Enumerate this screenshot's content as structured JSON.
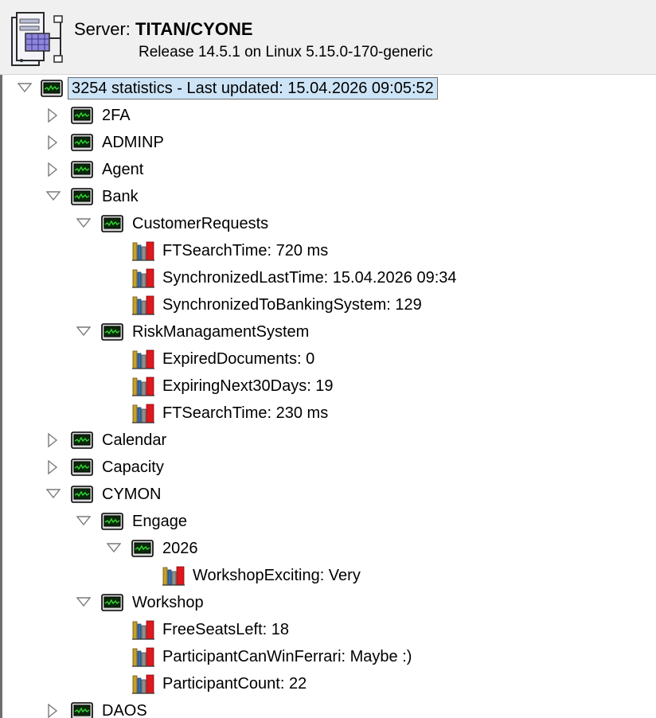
{
  "header": {
    "server_prefix": "Server:",
    "server_name": "TITAN/CYONE",
    "release": "Release 14.5.1 on Linux 5.15.0-170-generic"
  },
  "tree": {
    "root": "3254 statistics - Last updated: 15.04.2026 09:05:52",
    "n_2fa": "2FA",
    "n_adminp": "ADMINP",
    "n_agent": "Agent",
    "n_bank": "Bank",
    "n_customer_requests": "CustomerRequests",
    "s_ftsearch_720": "FTSearchTime: 720 ms",
    "s_sync_last": "SynchronizedLastTime: 15.04.2026 09:34",
    "s_sync_bank": "SynchronizedToBankingSystem: 129",
    "n_risk": "RiskManagamentSystem",
    "s_expired": "ExpiredDocuments: 0",
    "s_expiring": "ExpiringNext30Days: 19",
    "s_ftsearch_230": "FTSearchTime: 230 ms",
    "n_calendar": "Calendar",
    "n_capacity": "Capacity",
    "n_cymon": "CYMON",
    "n_engage": "Engage",
    "n_2026": "2026",
    "s_workshop_exciting": "WorkshopExciting: Very",
    "n_workshop": "Workshop",
    "s_free_seats": "FreeSeatsLeft: 18",
    "s_ferrari": "ParticipantCanWinFerrari: Maybe :)",
    "s_participant_count": "ParticipantCount: 22",
    "n_daos": "DAOS"
  }
}
